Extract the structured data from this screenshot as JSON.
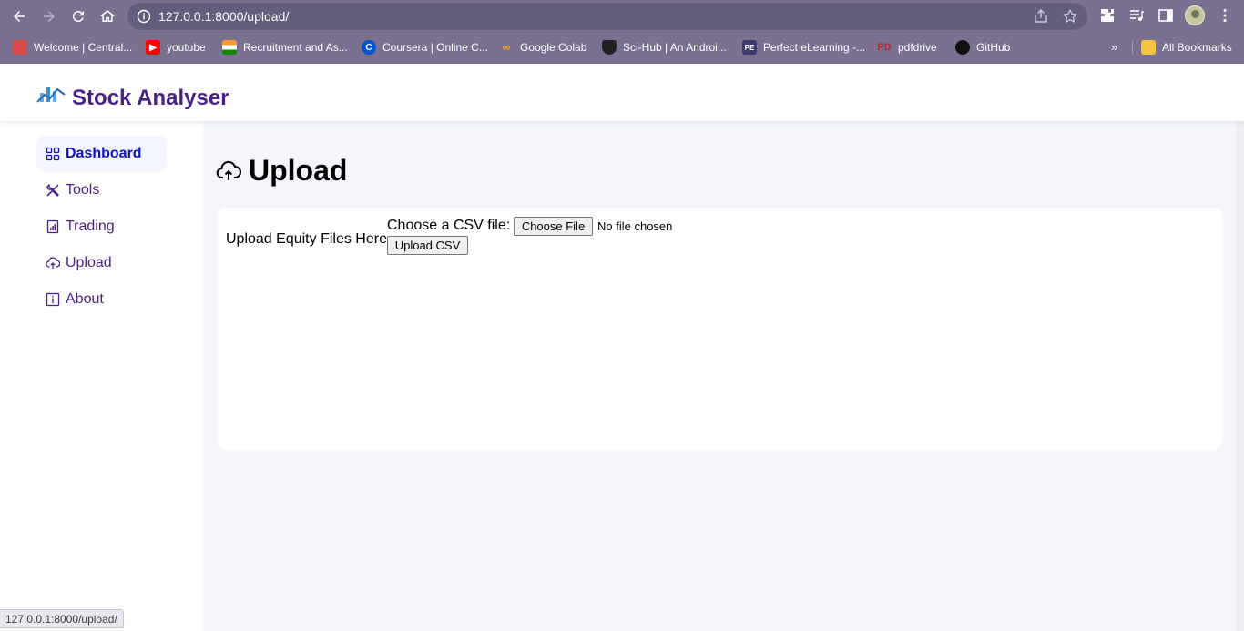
{
  "browser": {
    "url": "127.0.0.1:8000/upload/",
    "bookmarks": [
      {
        "label": "Welcome | Central...",
        "icon": "central-favicon-icon",
        "color": "#d94b4b"
      },
      {
        "label": "youtube",
        "icon": "youtube-icon",
        "color": "#ff0000"
      },
      {
        "label": "Recruitment and As...",
        "icon": "india-flag-icon",
        "color": "#ff9933"
      },
      {
        "label": "Coursera | Online C...",
        "icon": "coursera-icon",
        "color": "#0056d2"
      },
      {
        "label": "Google Colab",
        "icon": "colab-icon",
        "color": "#f9ab00"
      },
      {
        "label": "Sci-Hub | An Androi...",
        "icon": "scihub-icon",
        "color": "#222222"
      },
      {
        "label": "Perfect eLearning -...",
        "icon": "pe-icon",
        "color": "#3b3b6b"
      },
      {
        "label": "pdfdrive",
        "icon": "pdfdrive-icon",
        "color": "#b02a2a"
      },
      {
        "label": "GitHub",
        "icon": "github-icon",
        "color": "#111111"
      }
    ],
    "more_label": "»",
    "all_bookmarks_label": "All Bookmarks",
    "status_url": "127.0.0.1:8000/upload/"
  },
  "app": {
    "title": "Stock Analyser",
    "brand_color": "#4b1f8a"
  },
  "sidebar": {
    "items": [
      {
        "label": "Dashboard",
        "icon": "grid-icon",
        "active": true
      },
      {
        "label": "Tools",
        "icon": "tools-icon",
        "active": false
      },
      {
        "label": "Trading",
        "icon": "chart-icon",
        "active": false
      },
      {
        "label": "Upload",
        "icon": "cloud-upload-icon",
        "active": false
      },
      {
        "label": "About",
        "icon": "info-icon",
        "active": false
      }
    ]
  },
  "main": {
    "heading": "Upload",
    "card": {
      "label": "Upload Equity Files Here",
      "file_prompt": "Choose a CSV file:",
      "choose_button": "Choose File",
      "no_file": "No file chosen",
      "upload_button": "Upload CSV"
    }
  }
}
